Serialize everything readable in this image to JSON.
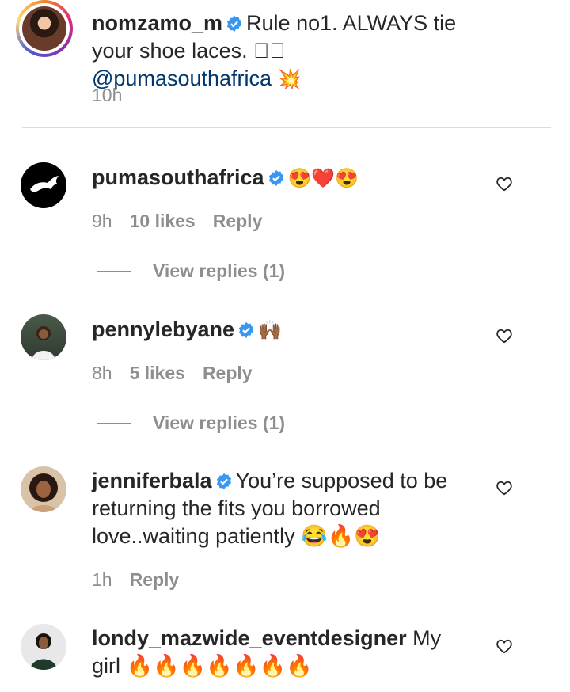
{
  "post": {
    "username": "nomzamo_m",
    "caption": "Rule no1. ALWAYS tie your shoe laces. 🏾🏾 ",
    "mention": "@pumasouthafrica",
    "emoji": "💥",
    "time": "10h"
  },
  "comments": [
    {
      "username": "pumasouthafrica",
      "text": "😍❤️😍",
      "time": "9h",
      "likes": "10 likes",
      "reply": "Reply",
      "view_replies": "View replies (1)"
    },
    {
      "username": "pennylebyane",
      "text": "🙌🏾",
      "time": "8h",
      "likes": "5 likes",
      "reply": "Reply",
      "view_replies": "View replies (1)"
    },
    {
      "username": "jenniferbala",
      "text": "You’re supposed to be returning the fits you borrowed love..waiting patiently 😂🔥😍",
      "time": "1h",
      "reply": "Reply"
    },
    {
      "username": "londy_mazwide_eventdesigner",
      "text": "My girl 🔥🔥🔥🔥🔥🔥🔥"
    }
  ],
  "colors": {
    "text": "#262626",
    "muted": "#8e8e8e",
    "mention": "#00376b",
    "verified": "#3897f0",
    "divider": "#dbdbdb"
  }
}
